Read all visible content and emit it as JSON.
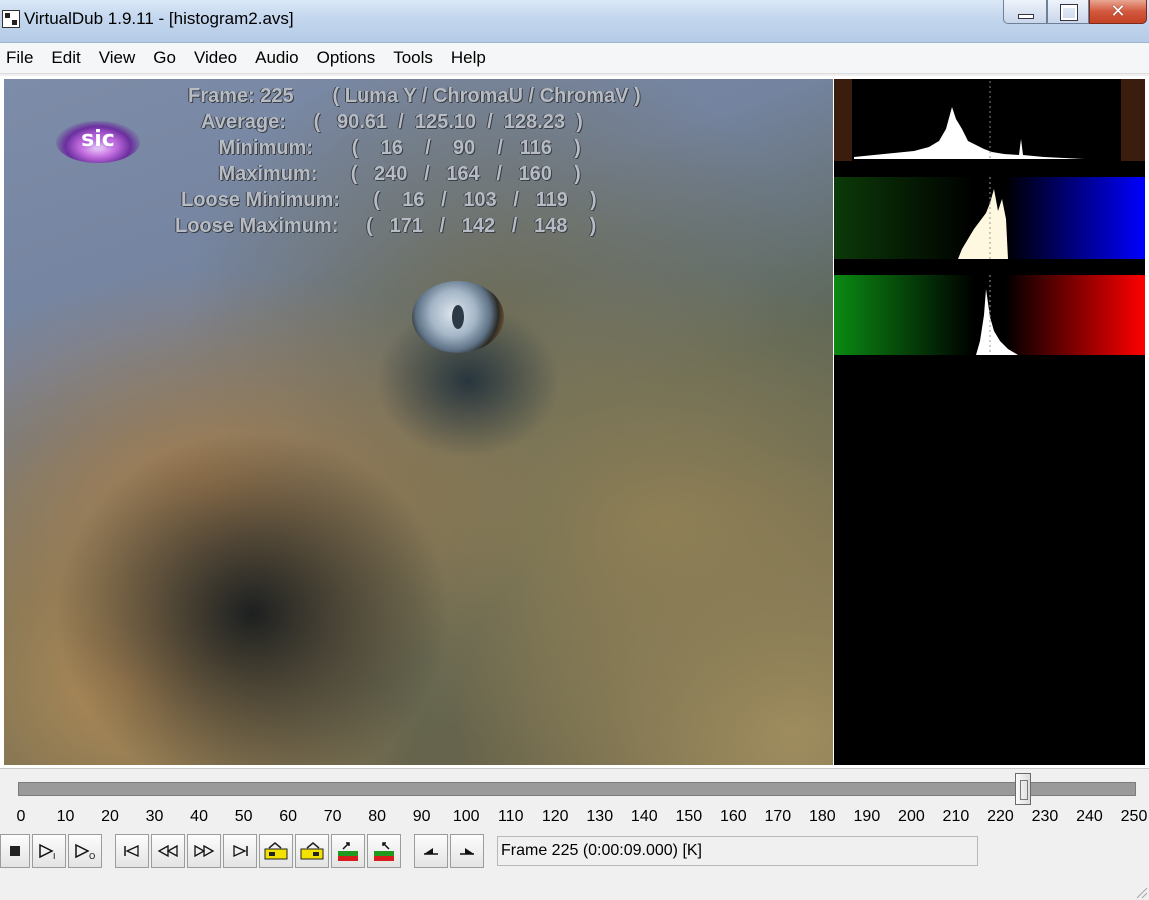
{
  "window": {
    "title": "VirtualDub 1.9.11 - [histogram2.avs]",
    "controls": {
      "minimize": "minimize",
      "maximize": "maximize",
      "close": "✕"
    }
  },
  "menu": [
    "File",
    "Edit",
    "View",
    "Go",
    "Video",
    "Audio",
    "Options",
    "Tools",
    "Help"
  ],
  "video_overlay": {
    "lines": [
      "Frame: 225       ( Luma Y / ChromaU / ChromaV )",
      "     Average:     (   90.61  /  125.10  /  128.23  )",
      "        Minimum:       (    16    /    90    /   116    )",
      "        Maximum:      (   240   /   164   /   160    )",
      "Loose Minimum:      (    16   /   103   /   119    )",
      "Loose Maximum:     (   171   /   142   /   148    )"
    ],
    "logo_text": "sic"
  },
  "histogram": {
    "panels": [
      "luma-y",
      "chroma-u",
      "chroma-v"
    ],
    "colors": {
      "u_low": "#003300",
      "u_high": "#0000ff",
      "v_low": "#00aa00",
      "v_high": "#ff0000",
      "luma_edge": "#3a1d0c"
    }
  },
  "timeline": {
    "ticks": [
      "0",
      "10",
      "20",
      "30",
      "40",
      "50",
      "60",
      "70",
      "80",
      "90",
      "100",
      "110",
      "120",
      "130",
      "140",
      "150",
      "160",
      "170",
      "180",
      "190",
      "200",
      "210",
      "220",
      "230",
      "240",
      "250"
    ],
    "min": 0,
    "max": 250,
    "current_frame": 225
  },
  "toolbar": {
    "buttons": [
      "stop-icon",
      "play-input-icon",
      "play-output-icon",
      "start-icon",
      "prev-key-icon",
      "next-key-icon",
      "end-icon",
      "prev-scene-icon",
      "next-scene-icon",
      "mark-in-icon",
      "mark-out-icon",
      "prev-frame-icon",
      "next-frame-icon"
    ],
    "status": "Frame 225 (0:00:09.000) [K]"
  }
}
